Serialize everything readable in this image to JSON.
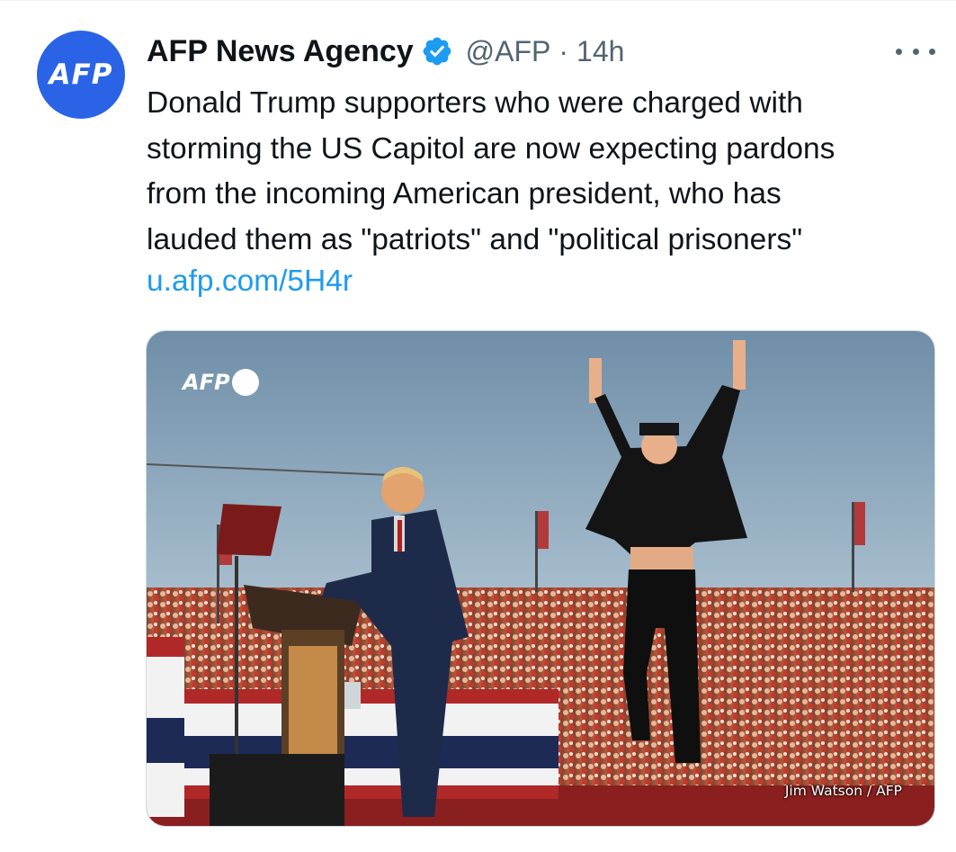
{
  "tweet": {
    "author": {
      "avatar_text": "AFP",
      "name": "AFP News Agency",
      "verified_icon": "verified-badge-icon",
      "handle": "@AFP",
      "separator": "·",
      "time": "14h"
    },
    "more_icon": "more-options-icon",
    "text_lines": [
      "Donald Trump supporters who were charged with",
      "storming the US Capitol are now expecting pardons",
      "from the incoming American president, who has",
      "lauded them as \"patriots\" and \"political prisoners\""
    ],
    "link": "u.afp.com/5H4r",
    "media": {
      "watermark_text": "AFP",
      "credit": "Jim Watson / AFP"
    }
  },
  "colors": {
    "brand_blue": "#2b63e6",
    "link_blue": "#1d9bf0",
    "verified_blue": "#1d9bf0",
    "secondary_text": "#536471"
  }
}
